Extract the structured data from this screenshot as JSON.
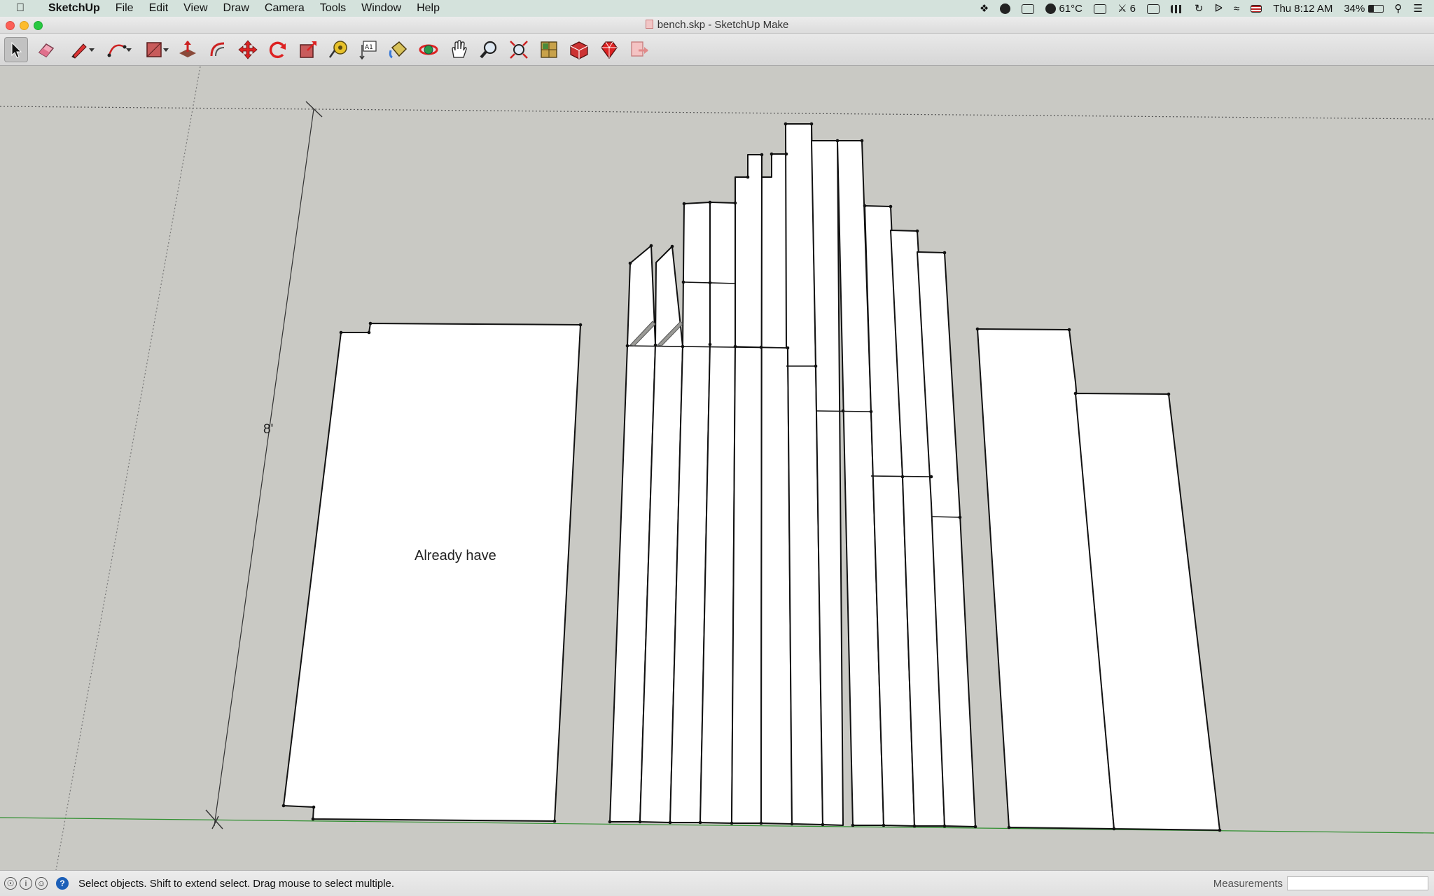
{
  "menubar": {
    "apple_icon": "apple-logo",
    "app_name": "SketchUp",
    "items": [
      "File",
      "Edit",
      "View",
      "Draw",
      "Camera",
      "Tools",
      "Window",
      "Help"
    ],
    "status": {
      "temperature": "61°C",
      "notif_count": "6",
      "clock": "Thu 8:12 AM",
      "battery": "34%"
    }
  },
  "window": {
    "title": "bench.skp - SketchUp Make"
  },
  "toolbar": {
    "tools": [
      {
        "name": "select-tool",
        "icon": "arrow-icon",
        "active": true
      },
      {
        "name": "eraser-tool",
        "icon": "eraser-icon"
      },
      {
        "name": "line-tool",
        "icon": "pencil-icon",
        "dropdown": true
      },
      {
        "name": "arc-tool",
        "icon": "arc-icon",
        "dropdown": true
      },
      {
        "name": "shapes-tool",
        "icon": "rectangle-icon",
        "dropdown": true
      },
      {
        "name": "push-pull-tool",
        "icon": "push-pull-icon"
      },
      {
        "name": "offset-tool",
        "icon": "offset-icon"
      },
      {
        "name": "move-tool",
        "icon": "move-icon"
      },
      {
        "name": "rotate-tool",
        "icon": "rotate-icon"
      },
      {
        "name": "scale-tool",
        "icon": "scale-icon"
      },
      {
        "name": "tape-measure-tool",
        "icon": "tape-measure-icon"
      },
      {
        "name": "text-tool",
        "icon": "text-icon"
      },
      {
        "name": "paint-bucket-tool",
        "icon": "paint-bucket-icon"
      },
      {
        "name": "orbit-tool",
        "icon": "orbit-icon"
      },
      {
        "name": "pan-tool",
        "icon": "hand-icon"
      },
      {
        "name": "zoom-tool",
        "icon": "zoom-icon"
      },
      {
        "name": "zoom-extents-tool",
        "icon": "zoom-extents-icon"
      },
      {
        "name": "warehouse-tool",
        "icon": "3d-warehouse-icon"
      },
      {
        "name": "extension-warehouse-tool",
        "icon": "extension-warehouse-icon"
      },
      {
        "name": "ruby-tool",
        "icon": "ruby-icon"
      },
      {
        "name": "layout-tool",
        "icon": "send-to-layout-icon"
      }
    ]
  },
  "canvas": {
    "dimension_label": "8'",
    "text_label": "Already have",
    "colors": {
      "background": "#c9c9c4",
      "face": "#ffffff",
      "edge": "#1a1a1a",
      "green_axis": "#2f8f2f"
    }
  },
  "statusbar": {
    "message": "Select objects. Shift to extend select. Drag mouse to select multiple.",
    "measurements_label": "Measurements",
    "measurements_value": ""
  }
}
